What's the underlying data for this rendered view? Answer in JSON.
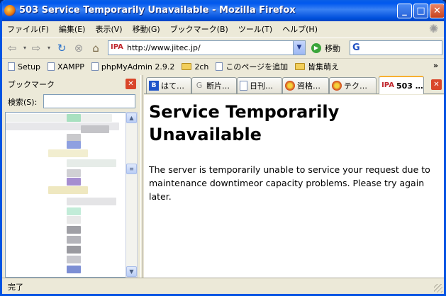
{
  "window": {
    "title": "503 Service Temporarily Unavailable - Mozilla Firefox"
  },
  "menubar": {
    "items": [
      "ファイル(F)",
      "編集(E)",
      "表示(V)",
      "移動(G)",
      "ブックマーク(B)",
      "ツール(T)",
      "ヘルプ(H)"
    ]
  },
  "navbar": {
    "url_badge": "IPA",
    "url": "http://www.jitec.jp/",
    "go_label": "移動",
    "search_engine_icon": "G"
  },
  "bookmarks_toolbar": {
    "items": [
      {
        "label": "Setup",
        "icon": "page-icon"
      },
      {
        "label": "XAMPP",
        "icon": "page-icon"
      },
      {
        "label": "phpMyAdmin 2.9.2",
        "icon": "page-icon"
      },
      {
        "label": "2ch",
        "icon": "folder-icon"
      },
      {
        "label": "このページを追加",
        "icon": "page-icon"
      },
      {
        "label": "皆集萌え",
        "icon": "folder-icon"
      }
    ],
    "overflow": "»"
  },
  "sidebar": {
    "title": "ブックマーク",
    "search_label": "検索(S):",
    "search_value": ""
  },
  "tabs": [
    {
      "label": "はて…",
      "icon": "B"
    },
    {
      "label": "断片…",
      "icon": "G"
    },
    {
      "label": "日刊…",
      "icon": ""
    },
    {
      "label": "資格…",
      "icon": ""
    },
    {
      "label": "テク…",
      "icon": ""
    },
    {
      "label": "503 …",
      "icon": "IPA",
      "active": true
    }
  ],
  "page": {
    "heading": "Service Temporarily Unavailable",
    "message": "The server is temporarily unable to service your request due to maintenance downtimeor capacity problems. Please try again later."
  },
  "status": {
    "text": "完了"
  }
}
